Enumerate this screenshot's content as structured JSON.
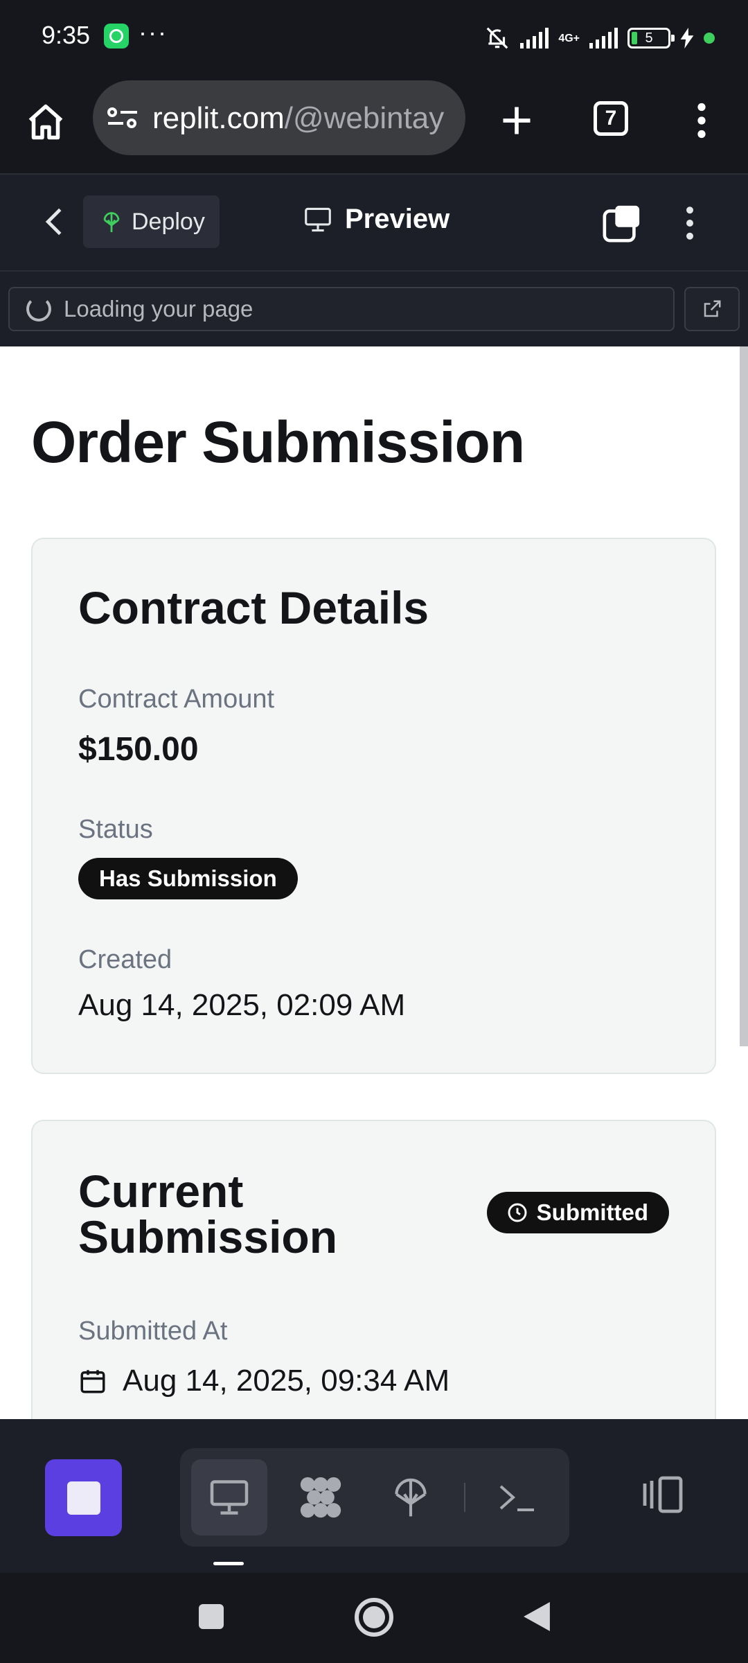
{
  "status_bar": {
    "time": "9:35",
    "overflow_dots": "···",
    "network_label": "4G+",
    "battery_level": "5"
  },
  "browser": {
    "url_domain": "replit.com",
    "url_path": "/@webintay",
    "tab_count": "7"
  },
  "replit_header": {
    "deploy_label": "Deploy",
    "preview_label": "Preview"
  },
  "loading": {
    "text": "Loading your page"
  },
  "page": {
    "title": "Order Submission",
    "contract_card": {
      "title": "Contract Details",
      "amount_label": "Contract Amount",
      "amount_value": "$150.00",
      "status_label": "Status",
      "status_badge": "Has Submission",
      "created_label": "Created",
      "created_value": "Aug 14, 2025, 02:09 AM"
    },
    "submission_card": {
      "title_line1": "Current",
      "title_line2": "Submission",
      "status_badge": "Submitted",
      "submitted_at_label": "Submitted At",
      "submitted_at_value": "Aug 14, 2025, 09:34 AM"
    }
  },
  "colors": {
    "accent_purple": "#5b3fe0",
    "badge_black": "#111111",
    "card_bg": "#f4f6f5",
    "deploy_green": "#3ecf5e"
  }
}
